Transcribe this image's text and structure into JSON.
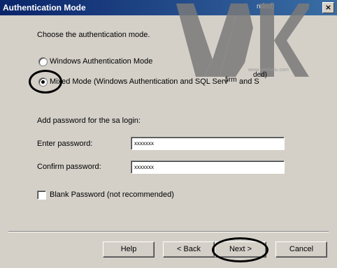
{
  "window": {
    "title": "Authentication Mode",
    "title_right_fragment": "nded)",
    "close_glyph": "×"
  },
  "prompt": "Choose the authentication mode.",
  "mode_options": [
    {
      "label": "Windows Authentication Mode",
      "selected": false
    },
    {
      "label": "Mixed Mode (Windows Authentication and SQL Server Authentication)",
      "display": "Mixed Mode (Windows Authentication and SQL Serv",
      "suffix": "and S",
      "selected": true
    }
  ],
  "overlay_text": {
    "fragment1": "firm",
    "fragment2": "ded)"
  },
  "password_section": {
    "heading": "Add password for the sa login:",
    "enter_label": "Enter password:",
    "enter_value": "xxxxxxx",
    "confirm_label": "Confirm password:",
    "confirm_value": "xxxxxxx",
    "blank_label": "Blank Password (not recommended)",
    "blank_checked": false
  },
  "buttons": {
    "help": "Help",
    "back": "< Back",
    "next": "Next >",
    "cancel": "Cancel"
  },
  "watermark": {
    "text": "www.weekmu.com",
    "color": "#7a7a7a"
  }
}
